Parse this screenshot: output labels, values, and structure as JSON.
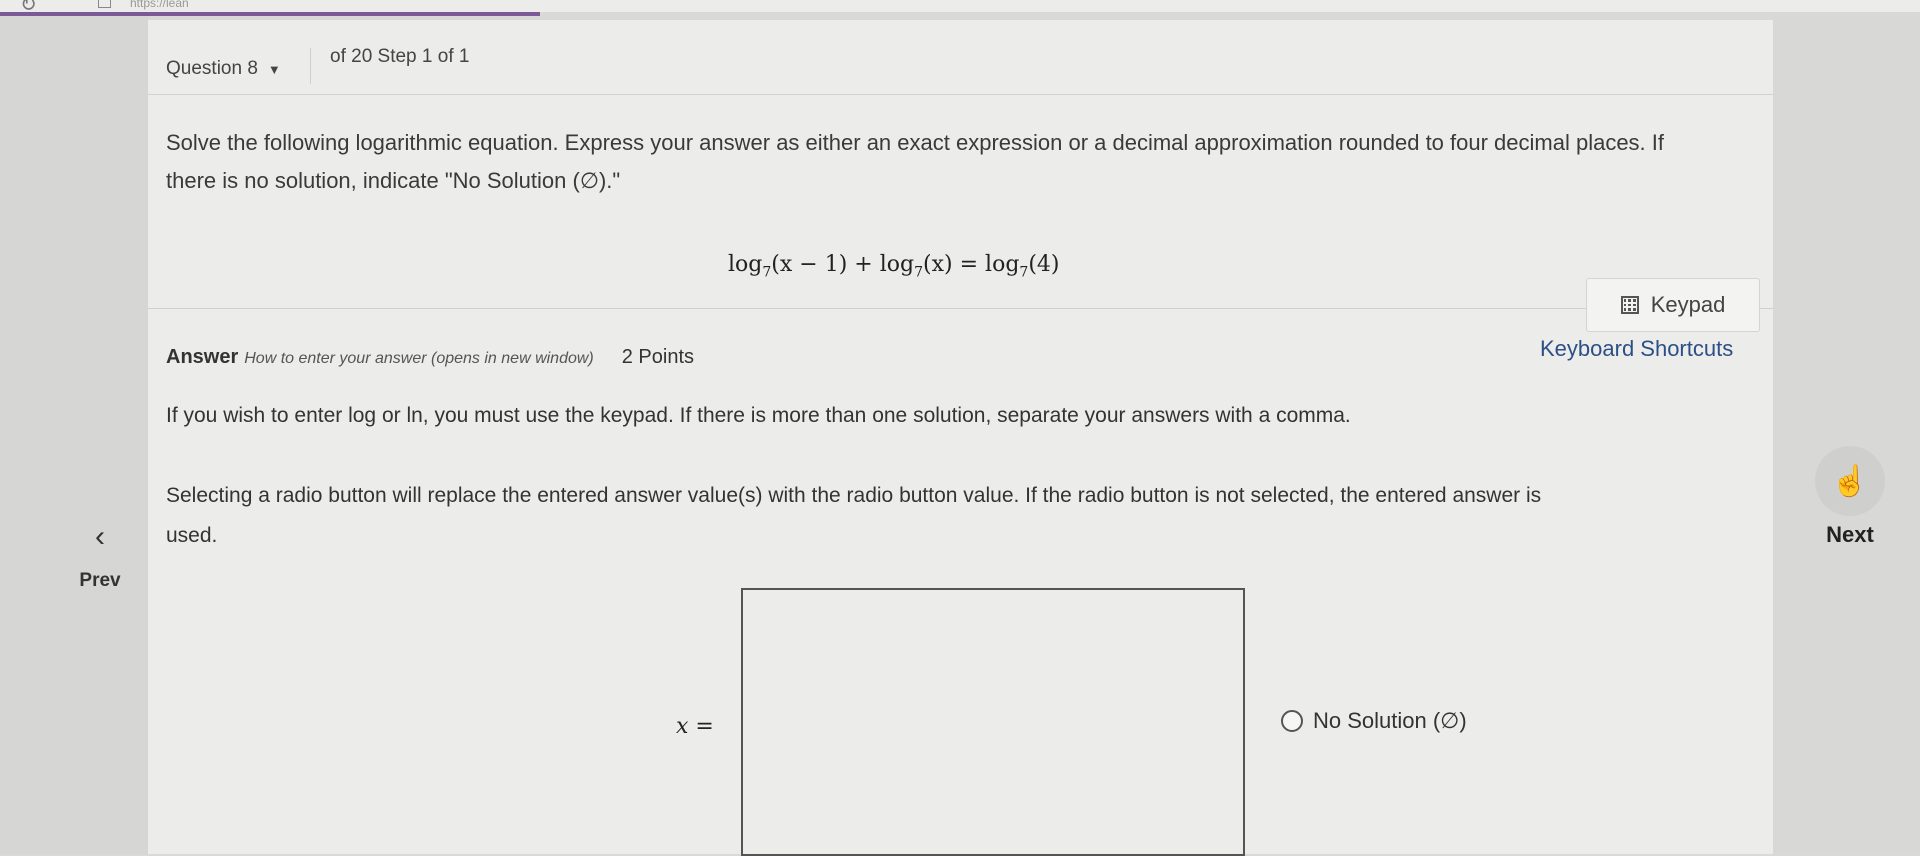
{
  "browser": {
    "url_fragment": "https://lean"
  },
  "header": {
    "question_selector": "Question 8",
    "progress": "of 20 Step 1 of 1"
  },
  "question": {
    "prompt": "Solve the following logarithmic equation. Express your answer as either an exact expression or a decimal approximation rounded to four decimal places. If there is no solution, indicate \"No Solution (∅).\"",
    "equation": {
      "term1_fn": "log",
      "term1_base": "7",
      "term1_arg": "(x − 1)",
      "op": "+",
      "term2_fn": "log",
      "term2_base": "7",
      "term2_arg": "(x)",
      "eq": "=",
      "rhs_fn": "log",
      "rhs_base": "7",
      "rhs_arg": "(4)"
    }
  },
  "tools": {
    "keypad_label": "Keypad",
    "shortcuts_label": "Keyboard Shortcuts"
  },
  "answer": {
    "label": "Answer",
    "howto_link": "How to enter your answer (opens in new window)",
    "points": "2 Points",
    "instruction_1": "If you wish to enter log or ln, you must use the keypad. If there is more than one solution, separate your answers with a comma.",
    "instruction_2": "Selecting a radio button will replace the entered answer value(s) with the radio button value. If the radio button is not selected, the entered answer is used.",
    "variable_label": "x =",
    "input_value": "",
    "no_solution_label": "No Solution (∅)"
  },
  "nav": {
    "prev_label": "Prev",
    "prev_icon": "chevron-left-icon",
    "next_label": "Next",
    "next_icon": "pointing-hand-icon"
  }
}
